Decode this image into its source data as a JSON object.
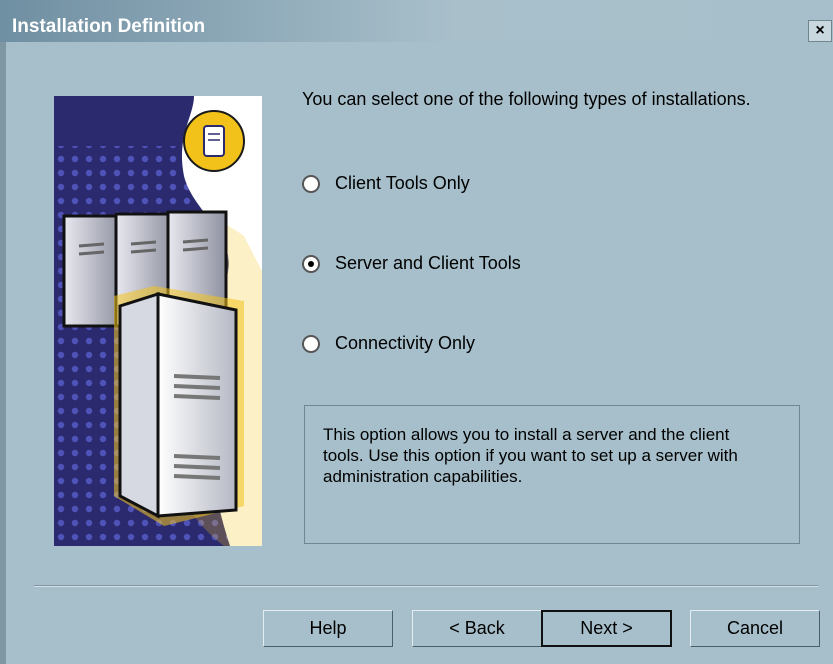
{
  "window": {
    "title": "Installation Definition",
    "close_label": "×"
  },
  "intro": "You can select one of the following types of installations.",
  "options": [
    {
      "label": "Client Tools Only",
      "selected": false
    },
    {
      "label": "Server and Client Tools",
      "selected": true
    },
    {
      "label": "Connectivity Only",
      "selected": false
    }
  ],
  "description": "This option allows you to install a server and the client tools. Use this option if you want to set up a server with administration capabilities.",
  "buttons": {
    "help": "Help",
    "back": "< Back",
    "next": "Next >",
    "cancel": "Cancel"
  },
  "colors": {
    "dialog_bg": "#a6bfca",
    "title_gradient_start": "#6f8fa2",
    "illustration_bg": "#2c2a6e",
    "accent_yellow": "#f2c21b"
  },
  "icons": {
    "close": "close-icon",
    "illustration": "server-illustration",
    "badge": "database-icon"
  }
}
